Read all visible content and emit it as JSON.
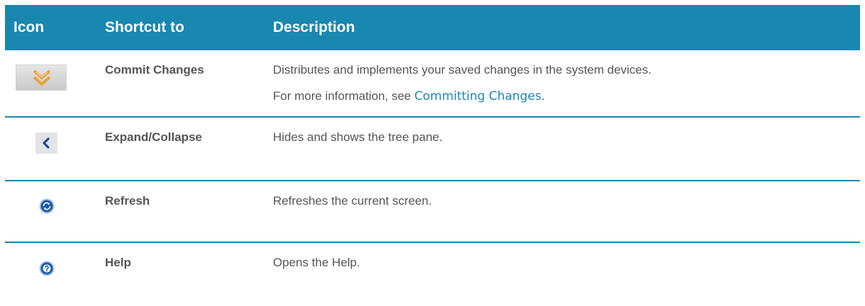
{
  "header": {
    "icon": "Icon",
    "shortcut": "Shortcut to",
    "description": "Description"
  },
  "rows": [
    {
      "icon": "commit-icon",
      "shortcut": "Commit Changes",
      "description": "Distributes and implements your saved changes in the system devices.",
      "note_prefix": "For more information, see ",
      "note_link": "Committing Changes",
      "note_suffix": "."
    },
    {
      "icon": "collapse-icon",
      "shortcut": "Expand/Collapse",
      "description": "Hides and shows the tree pane."
    },
    {
      "icon": "refresh-icon",
      "shortcut": "Refresh",
      "description": "Refreshes the current screen."
    },
    {
      "icon": "help-icon",
      "shortcut": "Help",
      "description": "Opens the Help."
    }
  ],
  "colors": {
    "accent": "#1a87b0",
    "text": "#555555",
    "icon_blue": "#1d5aa6",
    "commit_orange": "#e9a43a"
  }
}
